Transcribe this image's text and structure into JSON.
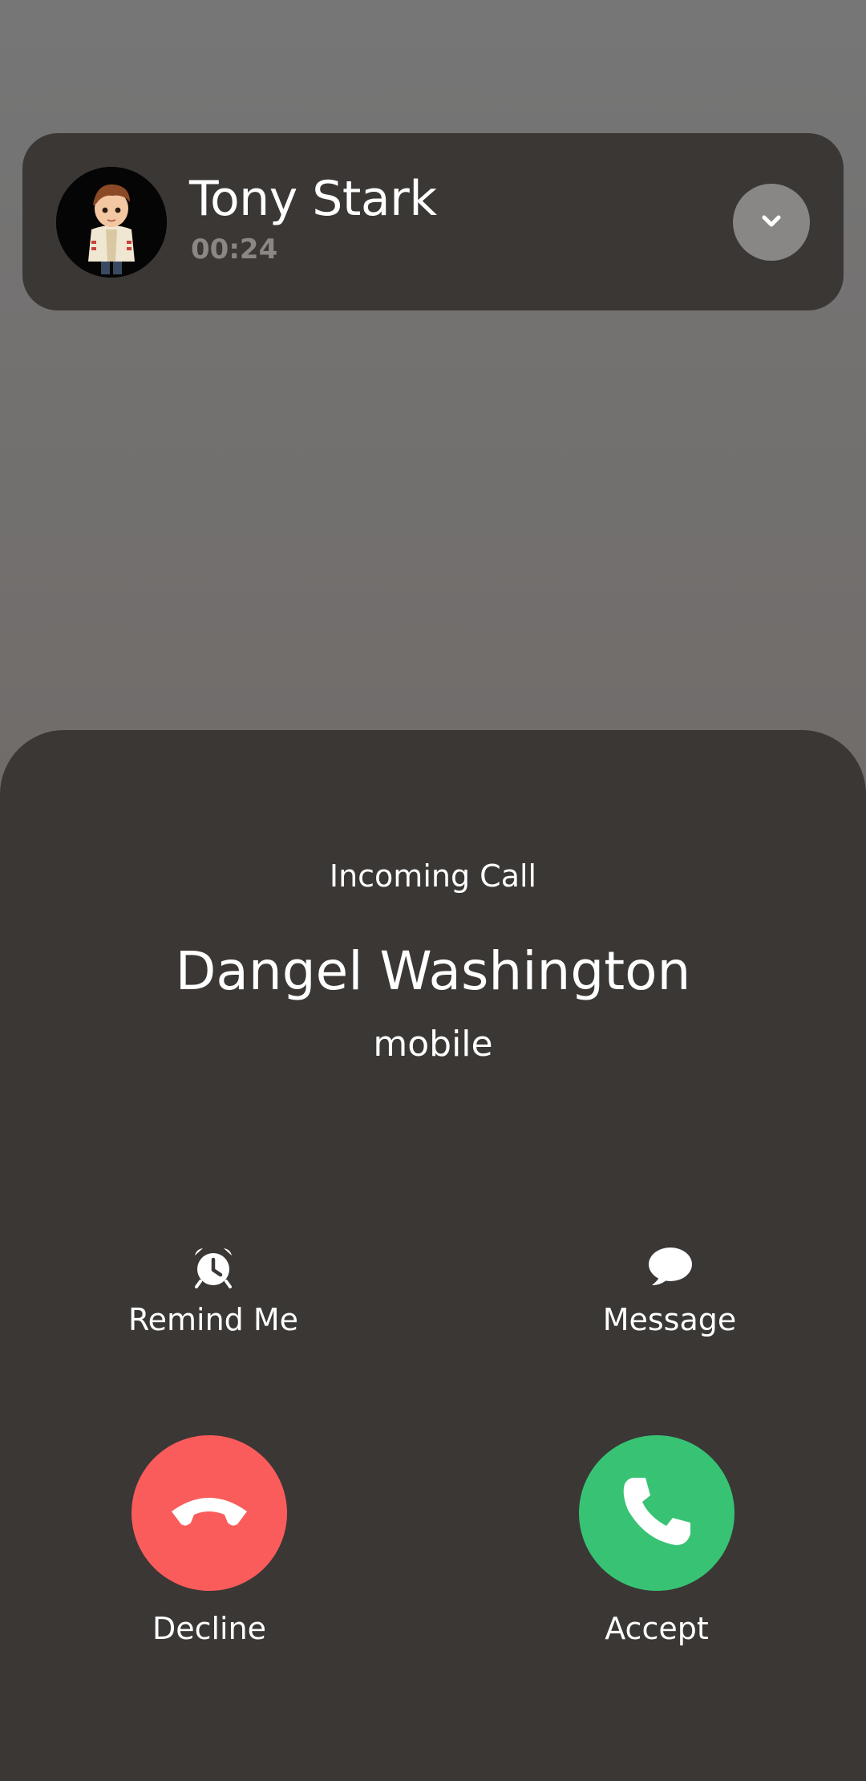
{
  "ongoing_call": {
    "name": "Tony Stark",
    "duration": "00:24",
    "avatar_icon": "cartoon-boy-avatar",
    "collapse_icon": "chevron-down-icon"
  },
  "incoming_call": {
    "title": "Incoming Call",
    "caller_name": "Dangel Washington",
    "number_type": "mobile"
  },
  "options": {
    "remind": {
      "label": "Remind Me",
      "icon": "alarm-clock-icon"
    },
    "message": {
      "label": "Message",
      "icon": "speech-bubble-icon"
    }
  },
  "actions": {
    "decline": {
      "label": "Decline",
      "icon": "hang-up-icon",
      "color": "#fa5c5c"
    },
    "accept": {
      "label": "Accept",
      "icon": "phone-icon",
      "color": "#38c374"
    }
  },
  "colors": {
    "panel": "#3a3735",
    "background": "#767676",
    "timer": "#8a8785"
  }
}
